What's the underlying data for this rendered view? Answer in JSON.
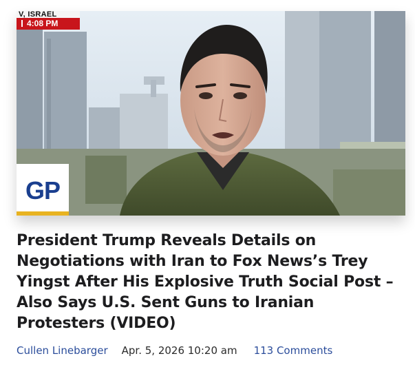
{
  "media": {
    "chyron": {
      "location_text": "V, ISRAEL",
      "time": "4:08 PM"
    },
    "logo": {
      "text": "GP",
      "text_color": "#1a3f8f",
      "accent_color": "#e8b321"
    }
  },
  "article": {
    "headline": "President Trump Reveals Details on Negotiations with Iran to Fox News’s Trey Yingst After His Explosive Truth Social Post – Also Says U.S. Sent Guns to Iranian Protesters (VIDEO)",
    "author": "Cullen Linebarger",
    "date": "Apr. 5, 2026 10:20 am",
    "comments": "113 Comments"
  },
  "colors": {
    "link": "#2b4d9b",
    "headline": "#1d1d1f",
    "chyron_red": "#c8151b"
  }
}
